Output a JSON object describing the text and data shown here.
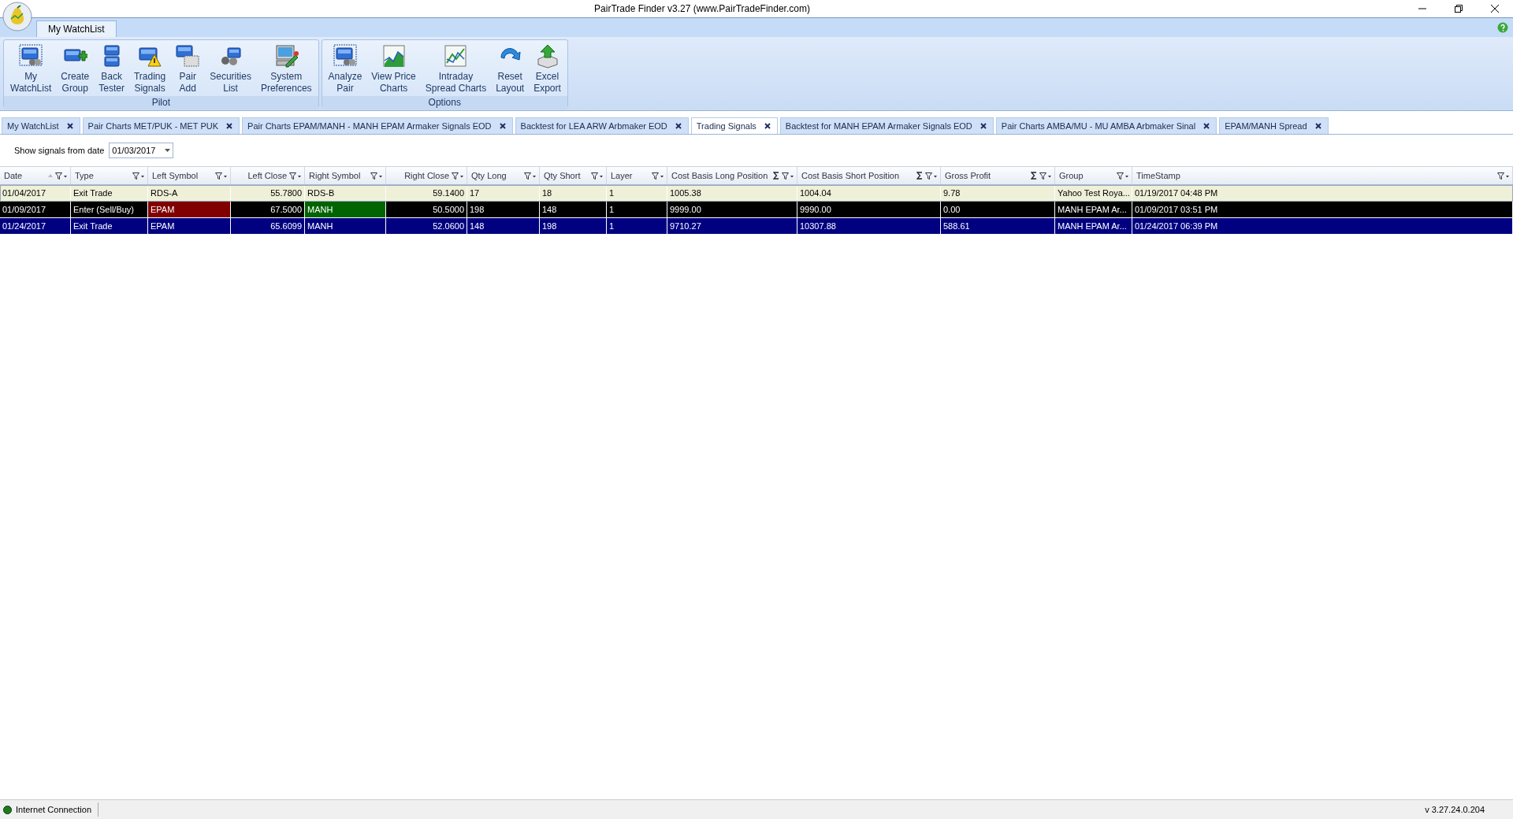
{
  "window": {
    "title": "PairTrade Finder v3.27 (www.PairTradeFinder.com)"
  },
  "ribbon": {
    "tabs": [
      {
        "label": "My WatchList",
        "selected": true
      }
    ],
    "groups": [
      {
        "label": "Pilot",
        "buttons": [
          {
            "kind": "watchlist",
            "label": "My\nWatchList"
          },
          {
            "kind": "create",
            "label": "Create\nGroup"
          },
          {
            "kind": "backtest",
            "label": "Back\nTester"
          },
          {
            "kind": "signals",
            "label": "Trading\nSignals"
          },
          {
            "kind": "add",
            "label": "Pair\nAdd"
          },
          {
            "kind": "securities",
            "label": "Securities\nList"
          },
          {
            "kind": "preferences",
            "label": "System\nPreferences"
          }
        ]
      },
      {
        "label": "Options",
        "buttons": [
          {
            "kind": "watchlist",
            "label": "Analyze\nPair"
          },
          {
            "kind": "chart",
            "label": "View Price\nCharts"
          },
          {
            "kind": "spread",
            "label": "Intraday\nSpread Charts"
          },
          {
            "kind": "reset",
            "label": "Reset\nLayout"
          },
          {
            "kind": "export",
            "label": "Excel\nExport"
          }
        ]
      }
    ]
  },
  "doc_tabs": [
    {
      "label": "My WatchList",
      "selected": false
    },
    {
      "label": "Pair Charts MET/PUK - MET PUK",
      "selected": false
    },
    {
      "label": "Pair Charts EPAM/MANH - MANH EPAM Armaker Signals EOD",
      "selected": false
    },
    {
      "label": "Backtest for LEA ARW Arbmaker EOD",
      "selected": false
    },
    {
      "label": "Trading Signals",
      "selected": true
    },
    {
      "label": "Backtest for MANH EPAM Armaker Signals EOD",
      "selected": false
    },
    {
      "label": "Pair Charts AMBA/MU - MU AMBA Arbmaker Sinal",
      "selected": false
    },
    {
      "label": "EPAM/MANH Spread",
      "selected": false
    }
  ],
  "filter": {
    "label": "Show signals from date",
    "value": "01/03/2017"
  },
  "table": {
    "columns": [
      {
        "label": "Date",
        "kind": "text",
        "sorted": true,
        "summary": false
      },
      {
        "label": "Type",
        "kind": "text",
        "sorted": false,
        "summary": false
      },
      {
        "label": "Left Symbol",
        "kind": "text",
        "sorted": false,
        "summary": false
      },
      {
        "label": "Left Close",
        "kind": "number",
        "sorted": false,
        "summary": false
      },
      {
        "label": "Right Symbol",
        "kind": "text",
        "sorted": false,
        "summary": false
      },
      {
        "label": "Right Close",
        "kind": "number",
        "sorted": false,
        "summary": false
      },
      {
        "label": "Qty Long",
        "kind": "text",
        "sorted": false,
        "summary": false
      },
      {
        "label": "Qty Short",
        "kind": "text",
        "sorted": false,
        "summary": false
      },
      {
        "label": "Layer",
        "kind": "text",
        "sorted": false,
        "summary": false
      },
      {
        "label": "Cost Basis Long Position",
        "kind": "text",
        "sorted": false,
        "summary": true
      },
      {
        "label": "Cost Basis Short Position",
        "kind": "text",
        "sorted": false,
        "summary": true
      },
      {
        "label": "Gross Profit",
        "kind": "text",
        "sorted": false,
        "summary": true
      },
      {
        "label": "Group",
        "kind": "text",
        "sorted": false,
        "summary": false
      },
      {
        "label": "TimeStamp",
        "kind": "text",
        "sorted": false,
        "summary": false
      }
    ],
    "rows": [
      {
        "color": "#eef0d8",
        "cells": [
          {
            "text": "01/04/2017"
          },
          {
            "text": "Exit Trade"
          },
          {
            "text": "RDS-A"
          },
          {
            "text": "55.7800"
          },
          {
            "text": "RDS-B"
          },
          {
            "text": "59.1400"
          },
          {
            "text": "17"
          },
          {
            "text": "18"
          },
          {
            "text": "1"
          },
          {
            "text": "1005.38"
          },
          {
            "text": "1004.04"
          },
          {
            "text": "9.78"
          },
          {
            "text": "Yahoo Test Roya..."
          },
          {
            "text": "01/19/2017 04:48 PM"
          }
        ]
      },
      {
        "color": "#000000",
        "cells": [
          {
            "text": "01/09/2017"
          },
          {
            "text": "Enter (Sell/Buy)"
          },
          {
            "text": "EPAM",
            "color": "#800000"
          },
          {
            "text": "67.5000"
          },
          {
            "text": "MANH",
            "color": "#006400"
          },
          {
            "text": "50.5000"
          },
          {
            "text": "198"
          },
          {
            "text": "148"
          },
          {
            "text": "1"
          },
          {
            "text": "9999.00"
          },
          {
            "text": "9990.00"
          },
          {
            "text": "0.00"
          },
          {
            "text": "MANH EPAM Ar..."
          },
          {
            "text": "01/09/2017 03:51 PM"
          }
        ]
      },
      {
        "color": "#000080",
        "cells": [
          {
            "text": "01/24/2017"
          },
          {
            "text": "Exit Trade"
          },
          {
            "text": "EPAM"
          },
          {
            "text": "65.6099"
          },
          {
            "text": "MANH"
          },
          {
            "text": "52.0600"
          },
          {
            "text": "148"
          },
          {
            "text": "198"
          },
          {
            "text": "1"
          },
          {
            "text": "9710.27"
          },
          {
            "text": "10307.88"
          },
          {
            "text": "588.61"
          },
          {
            "text": "MANH EPAM Ar..."
          },
          {
            "text": "01/24/2017 06:39 PM"
          }
        ]
      }
    ]
  },
  "status_bar": {
    "connection": "Internet Connection",
    "version": "v 3.27.24.0.204"
  }
}
